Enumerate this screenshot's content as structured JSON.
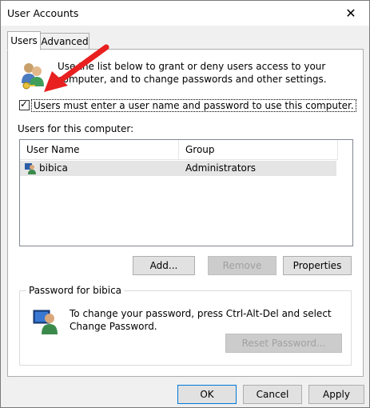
{
  "window": {
    "title": "User Accounts",
    "close_glyph": "✕"
  },
  "tabs": [
    {
      "label": "Users",
      "active": true
    },
    {
      "label": "Advanced",
      "active": false
    }
  ],
  "intro": {
    "text": "Use the list below to grant or deny users access to your computer, and to change passwords and other settings."
  },
  "require_login": {
    "checked": true,
    "label": "Users must enter a user name and password to use this computer."
  },
  "users_section": {
    "label": "Users for this computer:",
    "columns": [
      "User Name",
      "Group"
    ],
    "rows": [
      {
        "user": "bibica",
        "group": "Administrators",
        "icon": "user-icon"
      }
    ]
  },
  "user_buttons": {
    "add": "Add...",
    "remove": "Remove",
    "properties": "Properties"
  },
  "password_group": {
    "legend": "Password for bibica",
    "text": "To change your password, press Ctrl-Alt-Del and select Change Password.",
    "reset_button": "Reset Password..."
  },
  "dialog_buttons": {
    "ok": "OK",
    "cancel": "Cancel",
    "apply": "Apply"
  },
  "colors": {
    "arrow": "#e82020",
    "accent": "#0078d7"
  }
}
